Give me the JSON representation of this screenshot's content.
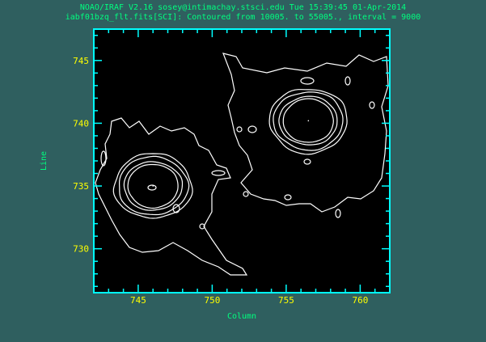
{
  "header": {
    "line1": "NOAO/IRAF V2.16 sosey@intimachay.stsci.edu Tue 15:39:45 01-Apr-2014",
    "line2": "iabf01bzq_flt.fits[SCI]: Contoured from 10005. to 55005., interval = 9000"
  },
  "colors": {
    "background": "#2f5f5f",
    "plot_background": "#000000",
    "frame": "#00ffff",
    "tick_labels": "#ffff00",
    "axis_labels": "#00ff7f",
    "contours": "#ffffff"
  },
  "chart_data": {
    "type": "contour",
    "title": "NOAO/IRAF V2.16 sosey@intimachay.stsci.edu Tue 15:39:45 01-Apr-2014",
    "subtitle": "iabf01bzq_flt.fits[SCI]: Contoured from 10005. to 55005., interval = 9000",
    "xlabel": "Column",
    "ylabel": "Line",
    "xlim": [
      742,
      762
    ],
    "ylim": [
      726.5,
      747.5
    ],
    "xticks": [
      745,
      750,
      755,
      760
    ],
    "yticks": [
      730,
      735,
      740,
      745
    ],
    "contour_levels": [
      10005,
      19005,
      28005,
      37005,
      46005,
      55005
    ],
    "sources": [
      {
        "x": 746.0,
        "y": 735.0
      },
      {
        "x": 756.5,
        "y": 740.2
      }
    ],
    "grid": false
  }
}
